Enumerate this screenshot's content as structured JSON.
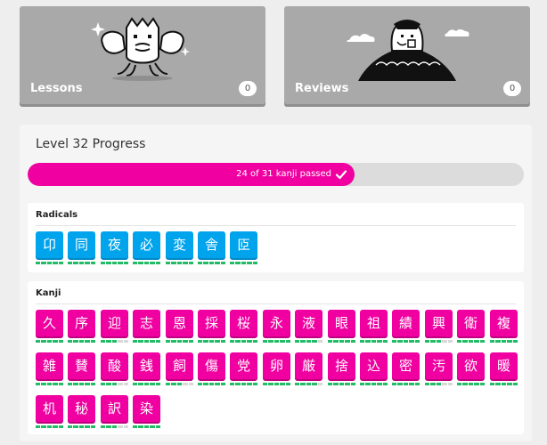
{
  "lessons": {
    "title": "Lessons",
    "count": "0"
  },
  "reviews": {
    "title": "Reviews",
    "count": "0"
  },
  "progress": {
    "title": "Level 32 Progress",
    "label": "24 of 31 kanji passed",
    "passed": 24,
    "total": 31,
    "fill_color": "#f000a0"
  },
  "radicals": {
    "title": "Radicals",
    "color": "#00a4ec",
    "items": [
      {
        "char": "卬",
        "stage": 5
      },
      {
        "char": "同",
        "stage": 5
      },
      {
        "char": "夜",
        "stage": 5
      },
      {
        "char": "必",
        "stage": 5
      },
      {
        "char": "変",
        "stage": 5
      },
      {
        "char": "舎",
        "stage": 5
      },
      {
        "char": "𦣝",
        "stage": 5
      }
    ]
  },
  "kanji": {
    "title": "Kanji",
    "color": "#f000a0",
    "items": [
      {
        "char": "久",
        "stage": 5
      },
      {
        "char": "序",
        "stage": 5
      },
      {
        "char": "迎",
        "stage": 3
      },
      {
        "char": "志",
        "stage": 5
      },
      {
        "char": "恩",
        "stage": 5
      },
      {
        "char": "採",
        "stage": 5
      },
      {
        "char": "桜",
        "stage": 5
      },
      {
        "char": "永",
        "stage": 5
      },
      {
        "char": "液",
        "stage": 4
      },
      {
        "char": "眼",
        "stage": 5
      },
      {
        "char": "祖",
        "stage": 5
      },
      {
        "char": "績",
        "stage": 5
      },
      {
        "char": "興",
        "stage": 3
      },
      {
        "char": "衛",
        "stage": 5
      },
      {
        "char": "複",
        "stage": 5
      },
      {
        "char": "雑",
        "stage": 5
      },
      {
        "char": "賛",
        "stage": 5
      },
      {
        "char": "酸",
        "stage": 3
      },
      {
        "char": "銭",
        "stage": 5
      },
      {
        "char": "飼",
        "stage": 3
      },
      {
        "char": "傷",
        "stage": 5
      },
      {
        "char": "党",
        "stage": 5
      },
      {
        "char": "卵",
        "stage": 5
      },
      {
        "char": "厳",
        "stage": 4
      },
      {
        "char": "捨",
        "stage": 5
      },
      {
        "char": "込",
        "stage": 5
      },
      {
        "char": "密",
        "stage": 5
      },
      {
        "char": "汚",
        "stage": 3
      },
      {
        "char": "欲",
        "stage": 5
      },
      {
        "char": "暖",
        "stage": 5
      },
      {
        "char": "机",
        "stage": 5
      },
      {
        "char": "秘",
        "stage": 5
      },
      {
        "char": "訳",
        "stage": 3
      },
      {
        "char": "染",
        "stage": 5
      }
    ]
  },
  "icons": {
    "lessons_illustration": "crab-mascot-illustration",
    "reviews_illustration": "mascot-on-mountain-illustration",
    "check": "checkmark-icon"
  },
  "colors": {
    "srs_passed": "#22bb66",
    "srs_pending": "#d8d8d8",
    "card_bg": "#a9a9a9"
  }
}
